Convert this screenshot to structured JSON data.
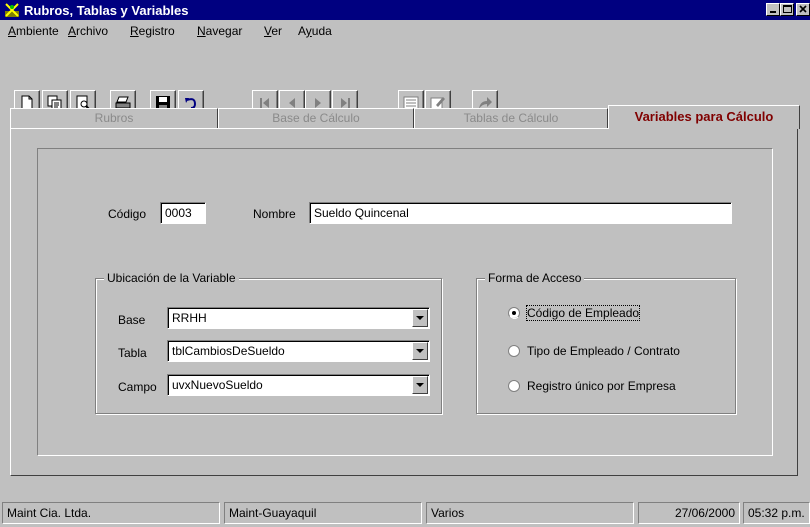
{
  "window": {
    "title": "Rubros, Tablas y Variables",
    "controls": [
      "minimize-icon",
      "maximize-icon",
      "close-icon"
    ]
  },
  "menu": [
    {
      "label": "Ambiente",
      "accel": "A",
      "rest": "mbiente"
    },
    {
      "label": "Archivo",
      "accel": "A",
      "rest": "rchivo"
    },
    {
      "label": "Registro",
      "accel": "R",
      "rest": "egistro"
    },
    {
      "label": "Navegar",
      "accel": "N",
      "rest": "avegar"
    },
    {
      "label": "Ver",
      "accel": "V",
      "rest": "er"
    },
    {
      "label": "Ayuda",
      "pre": "A",
      "accel": "y",
      "rest": "uda"
    }
  ],
  "toolbar": {
    "buttons": [
      "new-icon",
      "copy-icon",
      "preview-icon",
      "print-icon",
      "save-icon",
      "undo-icon",
      "first-record-icon",
      "previous-record-icon",
      "next-record-icon",
      "last-record-icon",
      "list-icon",
      "edit-icon",
      "exit-icon"
    ]
  },
  "tabs": [
    {
      "label": "Rubros",
      "active": false
    },
    {
      "label": "Base de Cálculo",
      "active": false
    },
    {
      "label": "Tablas de Cálculo",
      "active": false
    },
    {
      "label": "Variables para Cálculo",
      "active": true
    }
  ],
  "form": {
    "codigo_label": "Código",
    "codigo_value": "0003",
    "nombre_label": "Nombre",
    "nombre_value": "Sueldo Quincenal",
    "ubicacion": {
      "legend": "Ubicación de la Variable",
      "base_label": "Base",
      "base_value": "RRHH",
      "tabla_label": "Tabla",
      "tabla_value": "tblCambiosDeSueldo",
      "campo_label": "Campo",
      "campo_value": "uvxNuevoSueldo"
    },
    "acceso": {
      "legend": "Forma de Acceso",
      "options": [
        {
          "label": "Código de Empleado",
          "selected": true
        },
        {
          "label": "Tipo de Empleado / Contrato",
          "selected": false
        },
        {
          "label": "Registro único por Empresa",
          "selected": false
        }
      ]
    }
  },
  "status": {
    "company": "Maint Cia. Ltda.",
    "location": "Maint-Guayaquil",
    "module": "Varios",
    "date": "27/06/2000",
    "time": "05:32 p.m."
  },
  "colors": {
    "titlebar": "#000080",
    "face": "#c0c0c0",
    "active_tab_text": "#800000",
    "inactive_tab_text": "#8a8a8a"
  }
}
